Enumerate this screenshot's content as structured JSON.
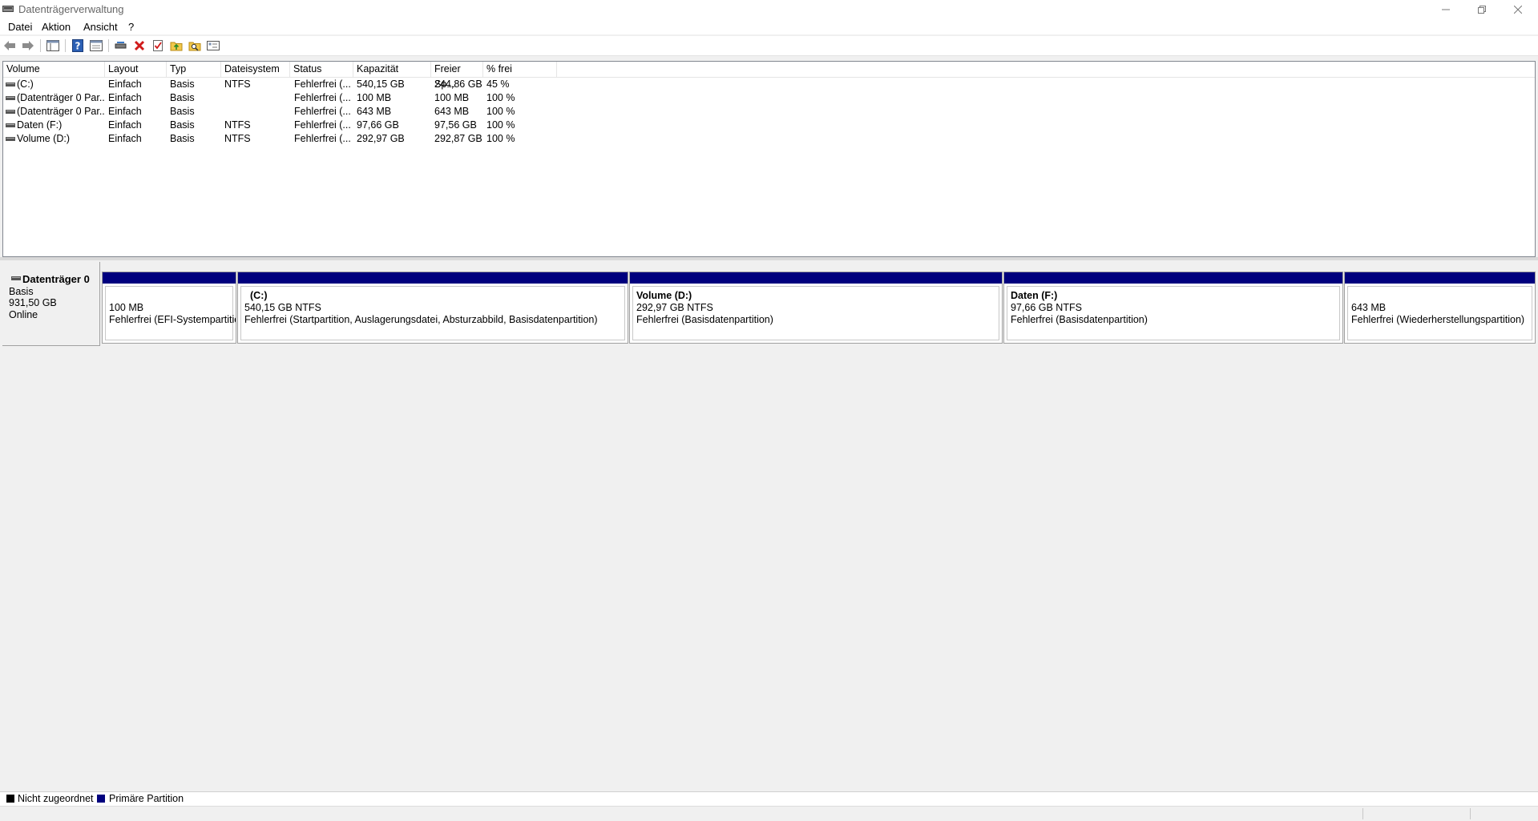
{
  "window": {
    "title": "Datenträgerverwaltung",
    "controls": [
      "minimize-icon",
      "restore-icon",
      "close-icon"
    ]
  },
  "menu": [
    "Datei",
    "Aktion",
    "Ansicht",
    "?"
  ],
  "toolbar": {
    "icons": [
      "back-arrow-icon",
      "forward-arrow-icon",
      "console-tree-icon",
      "help-icon",
      "properties-icon",
      "connect-disk-icon",
      "delete-icon",
      "check-icon",
      "folder-up-icon",
      "search-folder-icon",
      "settings-list-icon"
    ]
  },
  "volume_list": {
    "columns": [
      "Volume",
      "Layout",
      "Typ",
      "Dateisystem",
      "Status",
      "Kapazität",
      "Freier Sp...",
      "% frei"
    ],
    "rows": [
      [
        "(C:)",
        "Einfach",
        "Basis",
        "NTFS",
        "Fehlerfrei (...",
        "540,15 GB",
        "244,86 GB",
        "45 %"
      ],
      [
        "(Datenträger 0 Par...",
        "Einfach",
        "Basis",
        "",
        "Fehlerfrei (...",
        "100 MB",
        "100 MB",
        "100 %"
      ],
      [
        "(Datenträger 0 Par...",
        "Einfach",
        "Basis",
        "",
        "Fehlerfrei (...",
        "643 MB",
        "643 MB",
        "100 %"
      ],
      [
        "Daten (F:)",
        "Einfach",
        "Basis",
        "NTFS",
        "Fehlerfrei (...",
        "97,66 GB",
        "97,56 GB",
        "100 %"
      ],
      [
        "Volume (D:)",
        "Einfach",
        "Basis",
        "NTFS",
        "Fehlerfrei (...",
        "292,97 GB",
        "292,87 GB",
        "100 %"
      ]
    ]
  },
  "disk": {
    "name": "Datenträger 0",
    "type": "Basis",
    "size": "931,50 GB",
    "state": "Online",
    "partitions": [
      {
        "title": "",
        "size": "100 MB",
        "status": "Fehlerfrei (EFI-Systempartition)"
      },
      {
        "title": "(C:)",
        "size": "540,15 GB NTFS",
        "status": "Fehlerfrei (Startpartition, Auslagerungsdatei, Absturzabbild, Basisdatenpartition)"
      },
      {
        "title": "Volume  (D:)",
        "size": "292,97 GB NTFS",
        "status": "Fehlerfrei (Basisdatenpartition)"
      },
      {
        "title": "Daten  (F:)",
        "size": "97,66 GB NTFS",
        "status": "Fehlerfrei (Basisdatenpartition)"
      },
      {
        "title": "",
        "size": "643 MB",
        "status": "Fehlerfrei (Wiederherstellungspartition)"
      }
    ]
  },
  "legend": [
    {
      "label": "Nicht zugeordnet",
      "color": "#000000"
    },
    {
      "label": "Primäre Partition",
      "color": "#00007e"
    }
  ],
  "colors": {
    "primary_partition": "#00007e",
    "unallocated": "#000000"
  }
}
